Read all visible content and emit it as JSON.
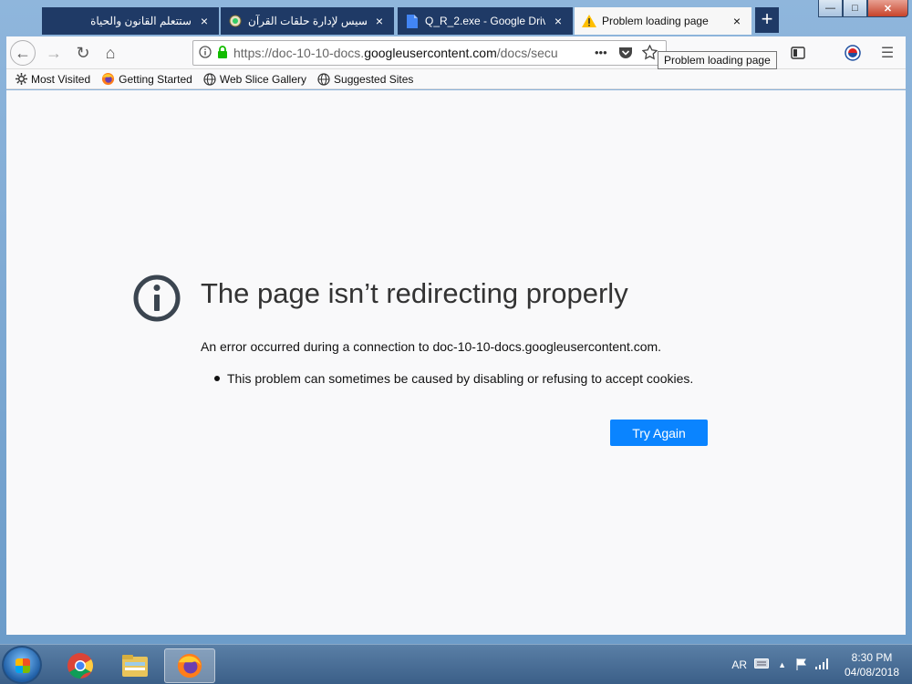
{
  "tabs": [
    {
      "label": "ستتعلم القانون والحياة",
      "close": "×"
    },
    {
      "label": "مطلوب أكسيس لإدارة حلقات القرآن",
      "close": "×"
    },
    {
      "label": "Q_R_2.exe - Google Drive",
      "close": "×"
    },
    {
      "label": "Problem loading page",
      "close": "×"
    }
  ],
  "new_tab": "+",
  "window_controls": {
    "minimize": "—",
    "maximize": "□",
    "close": "✕"
  },
  "toolbar": {
    "back_icon": "←",
    "forward_icon": "→",
    "reload_icon": "↻",
    "home_icon": "⌂",
    "url_prefix": "https://doc-10-10-docs.",
    "url_host": "googleusercontent.com",
    "url_suffix": "/docs/secu",
    "page_actions": "•••",
    "menu_icon": "☰"
  },
  "tooltip": "Problem loading page",
  "bookmarks": [
    {
      "label": "Most Visited",
      "icon": "gear-icon"
    },
    {
      "label": "Getting Started",
      "icon": "firefox-icon"
    },
    {
      "label": "Web Slice Gallery",
      "icon": "globe-icon"
    },
    {
      "label": "Suggested Sites",
      "icon": "globe-icon"
    }
  ],
  "error": {
    "title": "The page isn’t redirecting properly",
    "description": "An error occurred during a connection to doc-10-10-docs.googleusercontent.com.",
    "bullet": "This problem can sometimes be caused by disabling or refusing to accept cookies.",
    "button": "Try Again"
  },
  "taskbar": {
    "lang": "AR",
    "time": "8:30 PM",
    "date": "04/08/2018"
  },
  "colors": {
    "accent": "#0a84ff",
    "tab_dark": "#1f3a66"
  }
}
